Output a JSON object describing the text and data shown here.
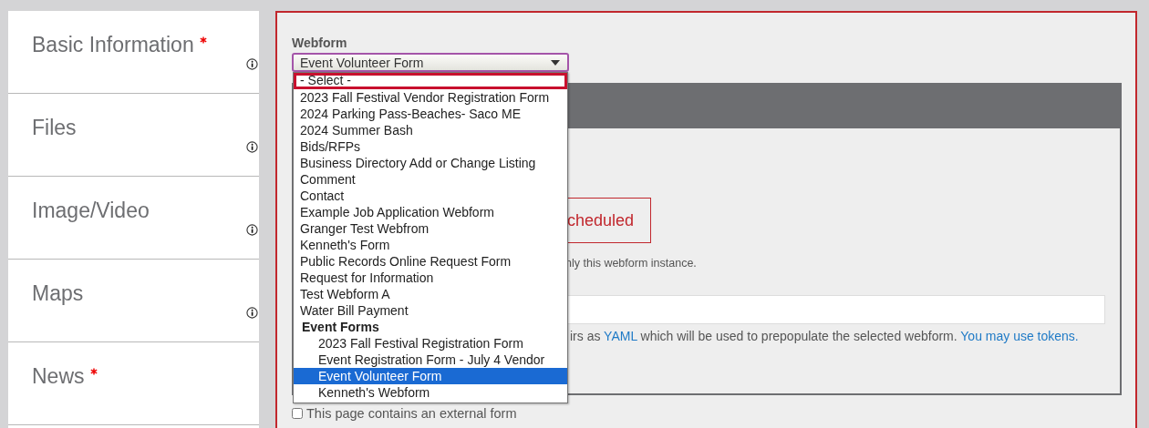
{
  "sidebar": {
    "items": [
      {
        "label": "Basic Information",
        "required": true,
        "info": true
      },
      {
        "label": "Files",
        "required": false,
        "info": true
      },
      {
        "label": "Image/Video",
        "required": false,
        "info": true
      },
      {
        "label": "Maps",
        "required": false,
        "info": true
      },
      {
        "label": "News",
        "required": true,
        "info": false
      }
    ]
  },
  "webform": {
    "label": "Webform",
    "value": "Event Volunteer Form",
    "expanded": true,
    "options": [
      {
        "kind": "option",
        "label": "- Select -",
        "focused": true,
        "selected": false
      },
      {
        "kind": "option",
        "label": "2023 Fall Festival Vendor Registration Form",
        "focused": false,
        "selected": false
      },
      {
        "kind": "option",
        "label": "2024 Parking Pass-Beaches- Saco ME",
        "focused": false,
        "selected": false
      },
      {
        "kind": "option",
        "label": "2024 Summer Bash",
        "focused": false,
        "selected": false
      },
      {
        "kind": "option",
        "label": "Bids/RFPs",
        "focused": false,
        "selected": false
      },
      {
        "kind": "option",
        "label": "Business Directory Add or Change Listing",
        "focused": false,
        "selected": false
      },
      {
        "kind": "option",
        "label": "Comment",
        "focused": false,
        "selected": false
      },
      {
        "kind": "option",
        "label": "Contact",
        "focused": false,
        "selected": false
      },
      {
        "kind": "option",
        "label": "Example Job Application Webform",
        "focused": false,
        "selected": false
      },
      {
        "kind": "option",
        "label": "Granger Test Webfrom",
        "focused": false,
        "selected": false
      },
      {
        "kind": "option",
        "label": "Kenneth's Form",
        "focused": false,
        "selected": false
      },
      {
        "kind": "option",
        "label": "Public Records Online Request Form",
        "focused": false,
        "selected": false
      },
      {
        "kind": "option",
        "label": "Request for Information",
        "focused": false,
        "selected": false
      },
      {
        "kind": "option",
        "label": "Test Webform A",
        "focused": false,
        "selected": false
      },
      {
        "kind": "option",
        "label": "Water Bill Payment",
        "focused": false,
        "selected": false
      },
      {
        "kind": "group",
        "label": "Event Forms",
        "children": [
          {
            "label": "2023 Fall Festival Registration Form",
            "focused": false,
            "selected": false
          },
          {
            "label": "Event Registration Form - July 4 Vendor",
            "focused": false,
            "selected": false
          },
          {
            "label": "Event Volunteer Form",
            "focused": false,
            "selected": true
          },
          {
            "label": "Kenneth's Webform",
            "focused": false,
            "selected": false
          }
        ]
      }
    ]
  },
  "status_button": "cheduled",
  "note": "nly this webform instance.",
  "help": [
    {
      "kind": "text",
      "text": "irs as "
    },
    {
      "kind": "link",
      "text": "YAML"
    },
    {
      "kind": "text",
      "text": " which will be used to prepopulate the selected webform. "
    },
    {
      "kind": "link",
      "text": "You may use tokens."
    }
  ],
  "external_form": {
    "label": "This page contains an external form",
    "checked": false
  }
}
